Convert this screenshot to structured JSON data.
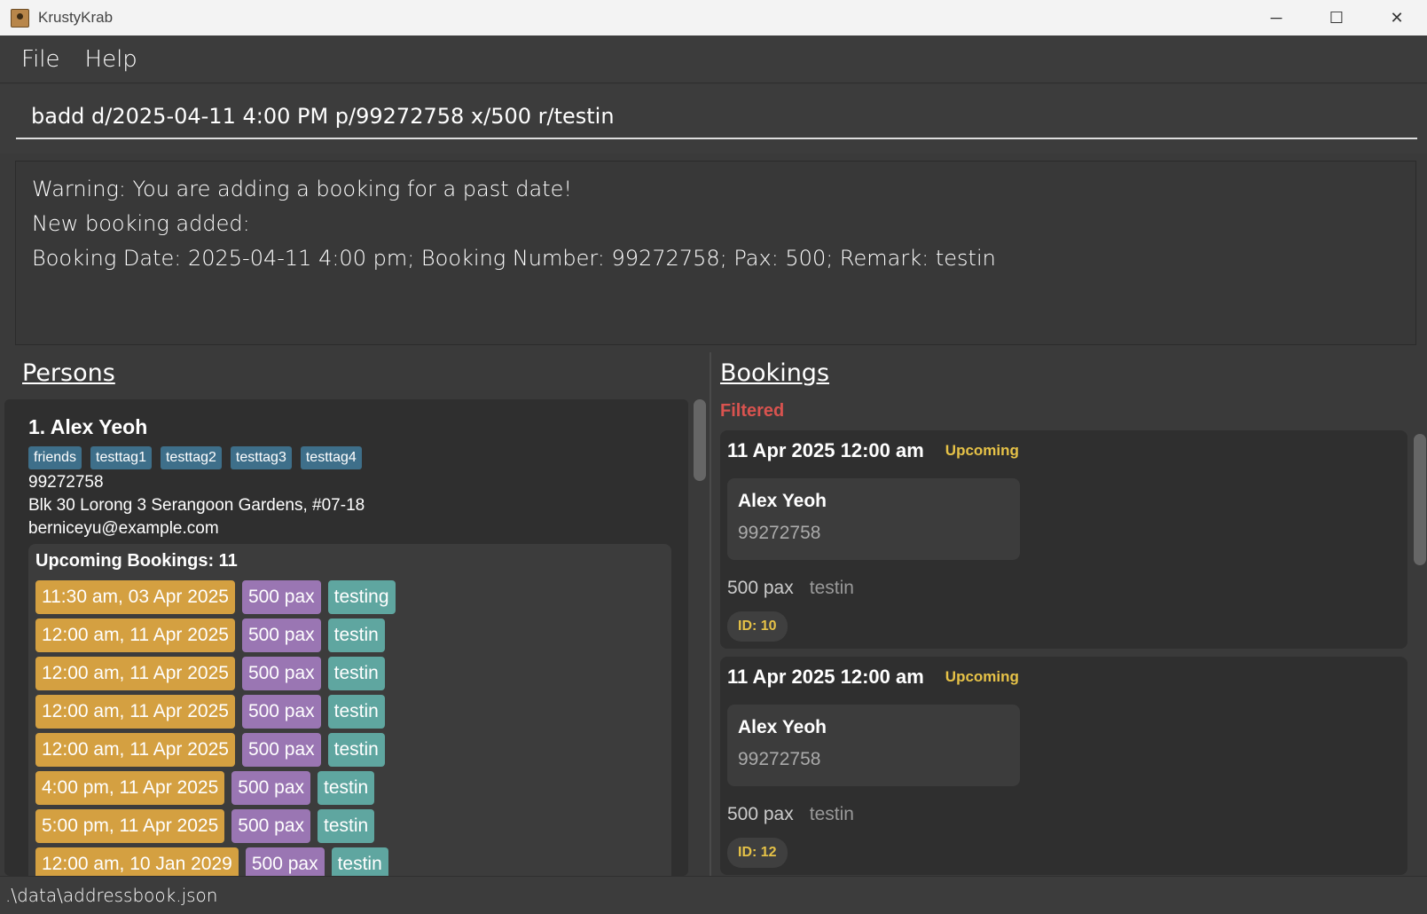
{
  "window": {
    "title": "KrustyKrab",
    "minimize": "─",
    "maximize": "☐",
    "close": "✕",
    "icon": "app-icon"
  },
  "menu": {
    "file": "File",
    "help": "Help"
  },
  "command": {
    "value": "badd d/2025-04-11 4:00 PM p/99272758 x/500 r/testin"
  },
  "result": {
    "lines": [
      "Warning: You are adding a booking for a past date!",
      "New booking added:",
      "Booking Date: 2025-04-11 4:00 pm; Booking Number: 99272758; Pax: 500; Remark: testin"
    ]
  },
  "persons": {
    "heading": "Persons",
    "cards": [
      {
        "name": "1. Alex Yeoh",
        "tags": [
          "friends",
          "testtag1",
          "testtag2",
          "testtag3",
          "testtag4"
        ],
        "phone": "99272758",
        "address": "Blk 30 Lorong 3 Serangoon Gardens, #07-18",
        "email": "berniceyu@example.com",
        "upcoming_label": "Upcoming Bookings:  11",
        "bookings": [
          {
            "date": "11:30 am, 03 Apr 2025",
            "pax": "500 pax",
            "remark": "testing"
          },
          {
            "date": "12:00 am, 11 Apr 2025",
            "pax": "500 pax",
            "remark": "testin"
          },
          {
            "date": "12:00 am, 11 Apr 2025",
            "pax": "500 pax",
            "remark": "testin"
          },
          {
            "date": "12:00 am, 11 Apr 2025",
            "pax": "500 pax",
            "remark": "testin"
          },
          {
            "date": "12:00 am, 11 Apr 2025",
            "pax": "500 pax",
            "remark": "testin"
          },
          {
            "date": "4:00 pm, 11 Apr 2025",
            "pax": "500 pax",
            "remark": "testin"
          },
          {
            "date": "5:00 pm, 11 Apr 2025",
            "pax": "500 pax",
            "remark": "testin"
          },
          {
            "date": "12:00 am, 10 Jan 2029",
            "pax": "500 pax",
            "remark": "testin"
          }
        ]
      }
    ]
  },
  "bookings": {
    "heading": "Bookings",
    "filter_label": "Filtered",
    "cards": [
      {
        "date": "11 Apr 2025 12:00 am",
        "status": "Upcoming",
        "person_name": "Alex Yeoh",
        "person_phone": "99272758",
        "pax": "500 pax",
        "remark": "testin",
        "id": "ID: 10"
      },
      {
        "date": "11 Apr 2025 12:00 am",
        "status": "Upcoming",
        "person_name": "Alex Yeoh",
        "person_phone": "99272758",
        "pax": "500 pax",
        "remark": "testin",
        "id": "ID: 12"
      }
    ]
  },
  "status_bar": {
    "path": ".\\data\\addressbook.json"
  },
  "colors": {
    "booking_date_chip": "#d4a041",
    "pax_chip": "#9a76b3",
    "remark_chip": "#5fa6a0",
    "tag": "#3e6f8a",
    "status_upcoming": "#e6c247",
    "filtered": "#d9534f"
  }
}
